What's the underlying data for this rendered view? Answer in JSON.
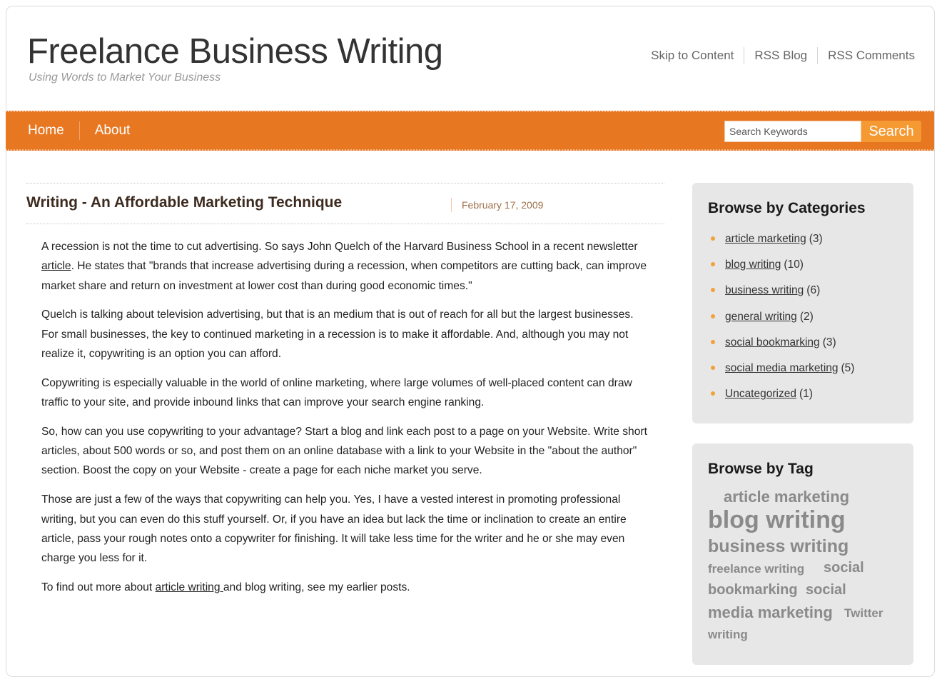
{
  "site": {
    "title": "Freelance Business Writing",
    "tagline": "Using Words to Market Your Business"
  },
  "top_links": [
    {
      "label": "Skip to Content"
    },
    {
      "label": "RSS Blog"
    },
    {
      "label": "RSS Comments"
    }
  ],
  "nav": {
    "items": [
      {
        "label": "Home"
      },
      {
        "label": "About"
      }
    ],
    "search": {
      "placeholder": "Search Keywords",
      "button_label": "Search"
    }
  },
  "post": {
    "title": "Writing - An Affordable Marketing Technique",
    "date": "February 17, 2009",
    "paragraphs": [
      {
        "before": "A recession is not the time to cut advertising. So says John Quelch of the Harvard Business School in a recent newsletter ",
        "link": "article",
        "after": ". He states that \"brands that increase advertising during a recession, when competitors are cutting back, can improve market share and return on investment at lower cost than during good economic times.\""
      },
      {
        "text": "Quelch is talking about television advertising, but that is an medium that is out of reach for all but the largest businesses. For small businesses, the key to continued marketing in a recession is to make it affordable. And, although you may not realize it, copywriting is an option you can afford."
      },
      {
        "text": "Copywriting is especially valuable in the world of online marketing, where large volumes of well-placed content can draw traffic to your site, and provide inbound links that can improve your search engine ranking."
      },
      {
        "text": "So, how can you use copywriting to your advantage? Start a blog and link each post to a page on your Website. Write short articles, about 500 words or so, and post them on an online database with a link to your Website in the \"about the author\" section. Boost the copy on your Website - create a page for each niche market you serve."
      },
      {
        "text": "Those are just a few of the ways that copywriting can help you. Yes, I have a vested interest in promoting professional writing, but you can even do this stuff yourself. Or, if you have an idea but lack the time or inclination to create an entire article, pass your rough notes onto a copywriter for finishing. It will take less time for the writer and he or she may even charge you less for it."
      },
      {
        "before": "To find out more about ",
        "link": "article writing ",
        "after": "and blog writing, see my earlier posts."
      }
    ]
  },
  "sidebar": {
    "categories": {
      "title": "Browse by Categories",
      "items": [
        {
          "label": "article marketing",
          "count": "(3)"
        },
        {
          "label": "blog writing",
          "count": "(10)"
        },
        {
          "label": "business writing",
          "count": "(6)"
        },
        {
          "label": "general writing",
          "count": "(2)"
        },
        {
          "label": "social bookmarking",
          "count": "(3)"
        },
        {
          "label": "social media marketing",
          "count": "(5)"
        },
        {
          "label": "Uncategorized",
          "count": "(1)"
        }
      ]
    },
    "tags": {
      "title": "Browse by Tag",
      "items": [
        {
          "label": "article marketing"
        },
        {
          "label": "blog writing"
        },
        {
          "label": "business writing"
        },
        {
          "label": "freelance writing"
        },
        {
          "label": "social"
        },
        {
          "label": "bookmarking"
        },
        {
          "label": "social"
        },
        {
          "label": "media marketing"
        },
        {
          "label": "Twitter"
        },
        {
          "label": "writing"
        }
      ]
    }
  },
  "colors": {
    "nav_background": "#e87722",
    "search_button": "#f59a33",
    "widget_background": "#e7e7e7",
    "bullet": "#f2a23a",
    "post_date": "#a0714b"
  },
  "icons": {
    "category_bullet": "bullet-dot-icon"
  }
}
